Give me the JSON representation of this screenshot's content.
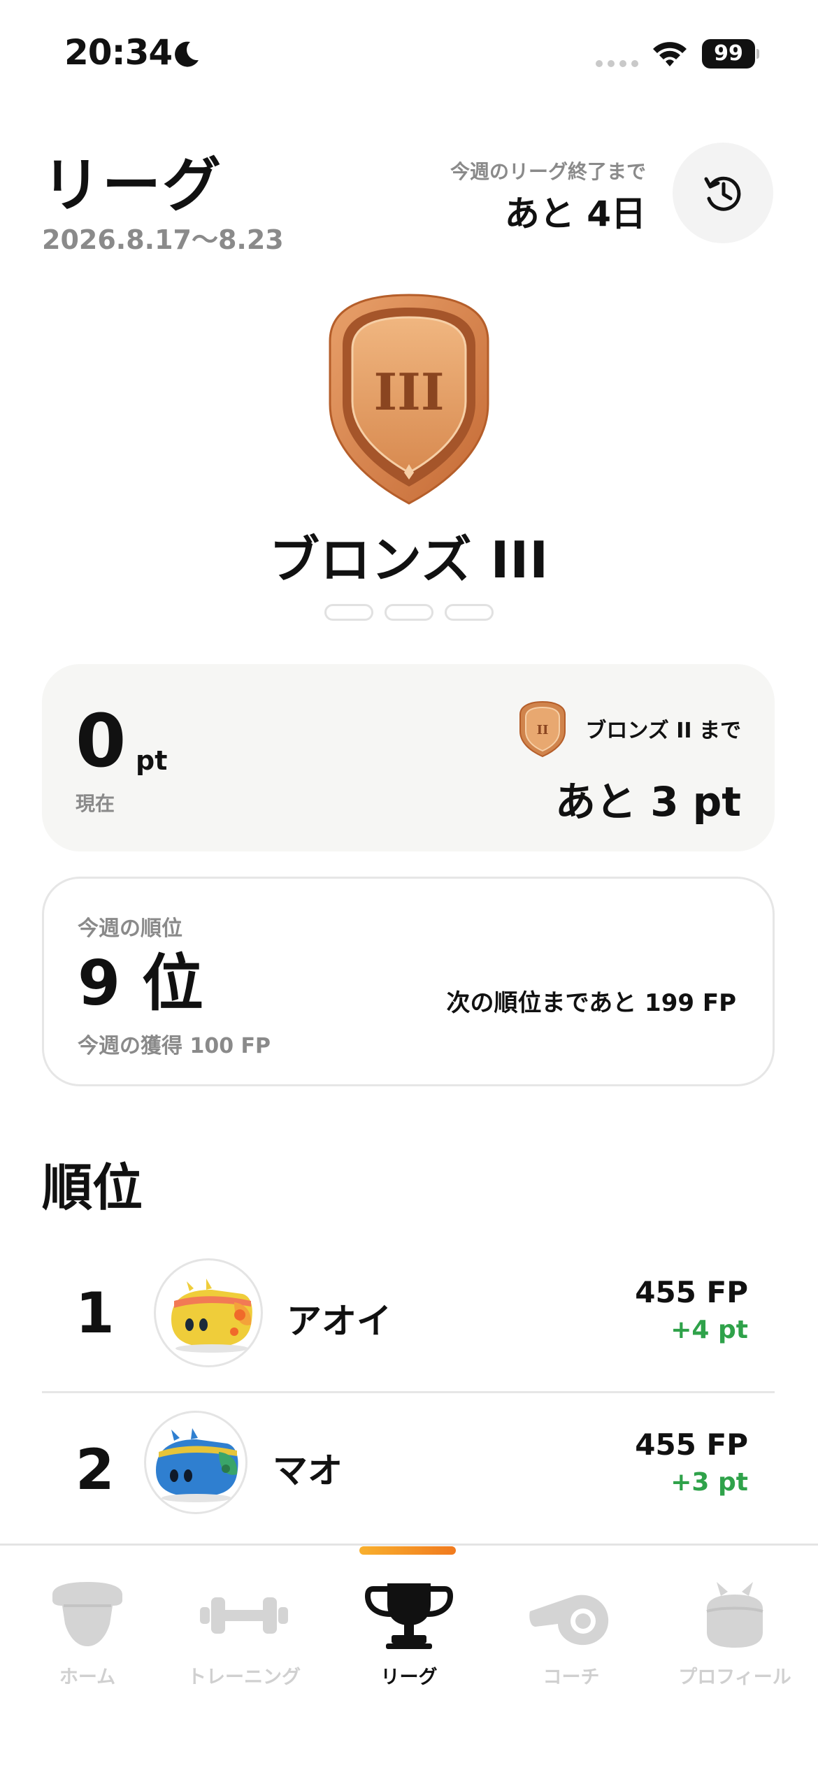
{
  "status_bar": {
    "time": "20:34",
    "battery": "99"
  },
  "header": {
    "title": "リーグ",
    "date_range": "2026.8.17〜8.23",
    "league_end_label": "今週のリーグ終了まで",
    "league_end_value": "あと 4日",
    "history_icon": "history-clock-icon"
  },
  "league": {
    "name": "ブロンズ III",
    "badge_numeral": "III",
    "badge_color": "#d0844c",
    "pages": 3
  },
  "points": {
    "value": "0",
    "unit": "pt",
    "caption": "現在",
    "next_badge_numeral": "II",
    "next_label": "ブロンズ II まで",
    "next_value": "あと 3 pt"
  },
  "weekly_rank": {
    "label": "今週の順位",
    "value": "9 位",
    "gained": "今週の獲得 100 FP",
    "next": "次の順位まであと 199 FP"
  },
  "ranking": {
    "title": "順位",
    "rows": [
      {
        "rank": "1",
        "name": "アオイ",
        "fp": "455 FP",
        "pt": "+4 pt",
        "avatar_color": "#efcd3a"
      },
      {
        "rank": "2",
        "name": "マオ",
        "fp": "455 FP",
        "pt": "+3 pt",
        "avatar_color": "#2f7fd0"
      }
    ]
  },
  "tabs": [
    {
      "label": "ホーム",
      "icon": "home-icon",
      "active": false
    },
    {
      "label": "トレーニング",
      "icon": "dumbbell-icon",
      "active": false
    },
    {
      "label": "リーグ",
      "icon": "trophy-icon",
      "active": true
    },
    {
      "label": "コーチ",
      "icon": "whistle-icon",
      "active": false
    },
    {
      "label": "プロフィール",
      "icon": "profile-icon",
      "active": false
    }
  ],
  "colors": {
    "accent": "#f39a26",
    "positive": "#2fa24a",
    "muted": "#8a8a8a"
  }
}
